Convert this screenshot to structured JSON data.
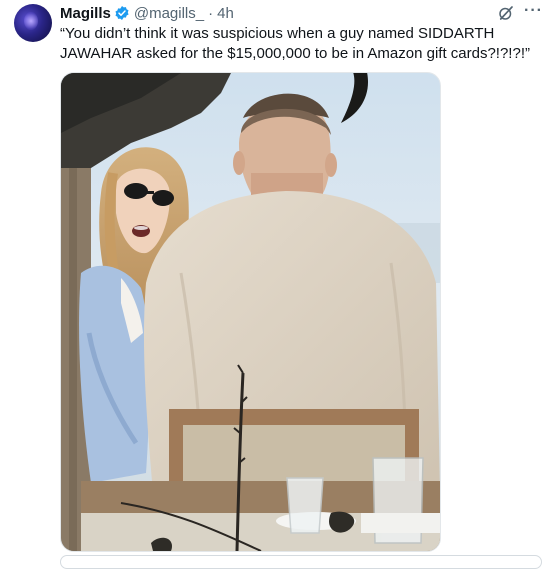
{
  "tweet": {
    "author_name": "Magills",
    "verified": true,
    "handle": "@magills_",
    "separator": "·",
    "time": "4h",
    "text": "“You didn’t think it was suspicious when a guy named SIDDARTH JAWAHAR asked for the $15,000,000 to be in Amazon gift cards?!?!?!”",
    "more_label": "···",
    "icons": {
      "verified": "verified-badge-icon",
      "grok": "grok-icon",
      "more": "more-options-icon"
    }
  },
  "colors": {
    "verified_blue": "#1d9bf0",
    "text": "#0f1419",
    "secondary_text": "#536471",
    "photo_border": "#e3e7ea"
  }
}
